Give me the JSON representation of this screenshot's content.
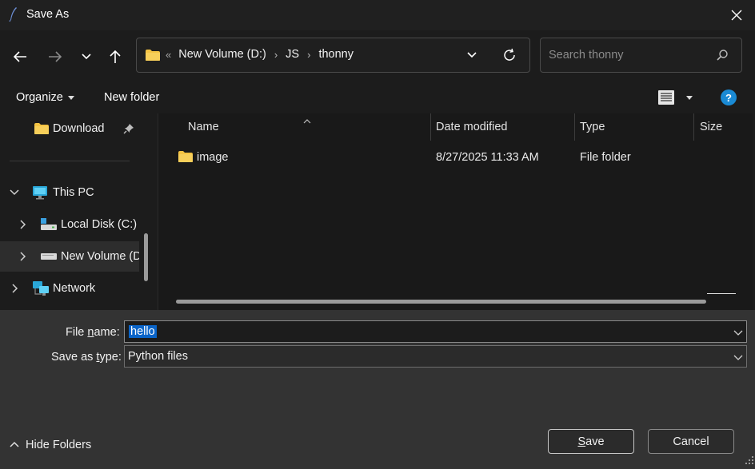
{
  "window": {
    "title": "Save As",
    "app_icon": "feather-icon"
  },
  "address": {
    "lead": "«",
    "crumbs": [
      "New Volume (D:)",
      "JS",
      "thonny"
    ]
  },
  "search": {
    "placeholder": "Search thonny"
  },
  "toolbar": {
    "organize_label": "Organize",
    "new_folder_label": "New folder",
    "help_label": "?"
  },
  "sidebar": {
    "items": [
      {
        "label": "Download",
        "icon": "folder-icon"
      },
      {
        "label": "This PC",
        "icon": "monitor-icon"
      },
      {
        "label": "Local Disk (C:)",
        "icon": "drive-icon"
      },
      {
        "label": "New Volume (D:)",
        "icon": "drive-icon"
      },
      {
        "label": "Network",
        "icon": "network-icon"
      }
    ]
  },
  "columns": {
    "name": "Name",
    "date": "Date modified",
    "type": "Type",
    "size": "Size"
  },
  "files": [
    {
      "name": "image",
      "date": "8/27/2025 11:33 AM",
      "type": "File folder",
      "size": ""
    }
  ],
  "form": {
    "file_name_label_pre": "File ",
    "file_name_label_u": "n",
    "file_name_label_post": "ame:",
    "file_name_value": "hello",
    "save_type_label_pre": "Save as ",
    "save_type_label_u": "t",
    "save_type_label_post": "ype:",
    "save_type_value": "Python files"
  },
  "footer": {
    "hide_folders_label": "Hide Folders",
    "save_label_u": "S",
    "save_label_rest": "ave",
    "cancel_label": "Cancel"
  },
  "colors": {
    "accent": "#0a64c8",
    "help_blue": "#1a8ad4",
    "folder_yellow": "#f4c343"
  }
}
